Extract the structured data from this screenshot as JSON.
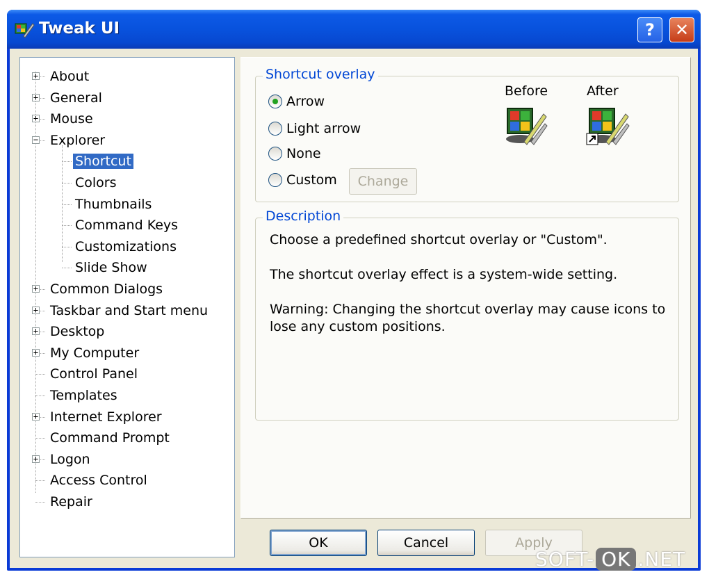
{
  "window": {
    "title": "Tweak UI",
    "help_label": "?",
    "close_label": "✕"
  },
  "tree": {
    "items": [
      {
        "label": "About",
        "expander": "+",
        "selected": false
      },
      {
        "label": "General",
        "expander": "+",
        "selected": false
      },
      {
        "label": "Mouse",
        "expander": "+",
        "selected": false
      },
      {
        "label": "Explorer",
        "expander": "−",
        "selected": false
      },
      {
        "label": "Shortcut",
        "expander": "",
        "selected": true
      },
      {
        "label": "Colors",
        "expander": "",
        "selected": false
      },
      {
        "label": "Thumbnails",
        "expander": "",
        "selected": false
      },
      {
        "label": "Command Keys",
        "expander": "",
        "selected": false
      },
      {
        "label": "Customizations",
        "expander": "",
        "selected": false
      },
      {
        "label": "Slide Show",
        "expander": "",
        "selected": false
      },
      {
        "label": "Common Dialogs",
        "expander": "+",
        "selected": false
      },
      {
        "label": "Taskbar and Start menu",
        "expander": "+",
        "selected": false
      },
      {
        "label": "Desktop",
        "expander": "+",
        "selected": false
      },
      {
        "label": "My Computer",
        "expander": "+",
        "selected": false
      },
      {
        "label": "Control Panel",
        "expander": "",
        "selected": false
      },
      {
        "label": "Templates",
        "expander": "",
        "selected": false
      },
      {
        "label": "Internet Explorer",
        "expander": "+",
        "selected": false
      },
      {
        "label": "Command Prompt",
        "expander": "",
        "selected": false
      },
      {
        "label": "Logon",
        "expander": "+",
        "selected": false
      },
      {
        "label": "Access Control",
        "expander": "",
        "selected": false
      },
      {
        "label": "Repair",
        "expander": "",
        "selected": false
      }
    ]
  },
  "shortcut_overlay": {
    "group_title": "Shortcut overlay",
    "options": [
      {
        "label": "Arrow",
        "checked": true
      },
      {
        "label": "Light arrow",
        "checked": false
      },
      {
        "label": "None",
        "checked": false
      },
      {
        "label": "Custom",
        "checked": false
      }
    ],
    "change_label": "Change",
    "before_label": "Before",
    "after_label": "After"
  },
  "description": {
    "group_title": "Description",
    "line1": "Choose a predefined shortcut overlay or \"Custom\".",
    "line2": "The shortcut overlay effect is a system-wide setting.",
    "line3": "Warning: Changing the shortcut overlay may cause icons to",
    "line4": "lose any custom positions."
  },
  "buttons": {
    "ok": "OK",
    "cancel": "Cancel",
    "apply": "Apply"
  },
  "watermark": {
    "prefix": "SOFT-",
    "badge": "OK",
    "suffix": ".NET"
  },
  "colors": {
    "titlebar": "#0852dd",
    "selection": "#316ac5",
    "group_title": "#0046d5",
    "radio_check": "#21a121"
  }
}
